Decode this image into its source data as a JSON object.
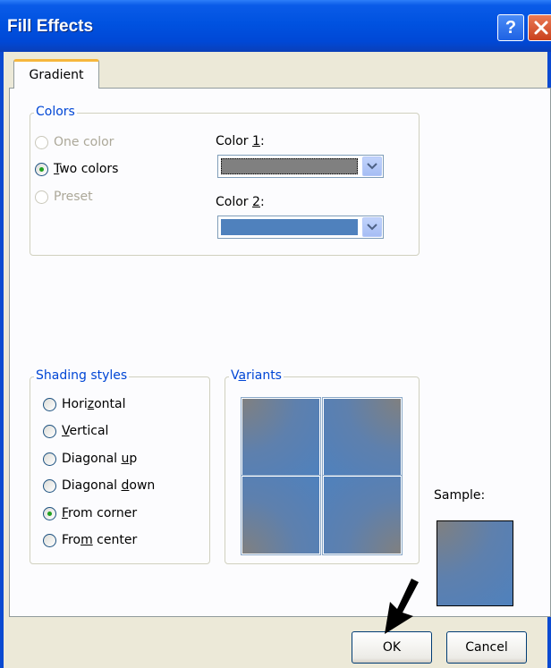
{
  "window": {
    "title": "Fill Effects",
    "help_symbol": "?"
  },
  "tabs": [
    {
      "label": "Gradient",
      "active": true
    }
  ],
  "colors_group": {
    "legend": "Colors",
    "options": [
      {
        "label": "One color",
        "selected": false,
        "enabled": false
      },
      {
        "label": "Two colors",
        "selected": true,
        "enabled": true
      },
      {
        "label": "Preset",
        "selected": false,
        "enabled": false
      }
    ],
    "color1": {
      "label_pre": "Color ",
      "label_key": "1",
      "label_post": ":",
      "value": "#808080"
    },
    "color2": {
      "label_pre": "Color ",
      "label_key": "2",
      "label_post": ":",
      "value": "#4f81bd"
    }
  },
  "shading_group": {
    "legend": "Shading styles",
    "options": [
      {
        "pre": "Hori",
        "key": "z",
        "post": "ontal",
        "selected": false
      },
      {
        "pre": "",
        "key": "V",
        "post": "ertical",
        "selected": false
      },
      {
        "pre": "Diagonal ",
        "key": "u",
        "post": "p",
        "selected": false
      },
      {
        "pre": "Diagonal ",
        "key": "d",
        "post": "own",
        "selected": false
      },
      {
        "pre": "",
        "key": "F",
        "post": "rom corner",
        "selected": true
      },
      {
        "pre": "Fro",
        "key": "m",
        "post": " center",
        "selected": false
      }
    ]
  },
  "variants_group": {
    "legend_pre": "V",
    "legend_key": "a",
    "legend_post": "riants"
  },
  "sample": {
    "label": "Sample:"
  },
  "buttons": {
    "ok": "OK",
    "cancel": "Cancel"
  },
  "colors": {
    "accent": "#0046d5",
    "color1": "#808080",
    "color2": "#4f81bd",
    "selected_radio": "#21a121"
  }
}
